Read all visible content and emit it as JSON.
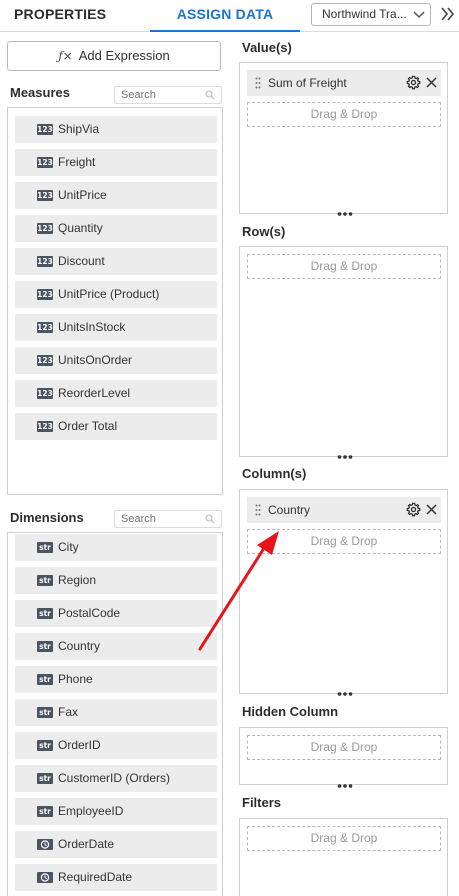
{
  "tabs": {
    "properties": "PROPERTIES",
    "assign_data": "ASSIGN DATA"
  },
  "datasource": {
    "selected": "Northwind Tra..."
  },
  "add_expression": {
    "icon_text": "ƒ×",
    "label": "Add Expression"
  },
  "measures": {
    "title": "Measures",
    "search_placeholder": "Search",
    "items": [
      {
        "type": "123",
        "label": "ShipVia"
      },
      {
        "type": "123",
        "label": "Freight"
      },
      {
        "type": "123",
        "label": "UnitPrice"
      },
      {
        "type": "123",
        "label": "Quantity"
      },
      {
        "type": "123",
        "label": "Discount"
      },
      {
        "type": "123",
        "label": "UnitPrice (Product)"
      },
      {
        "type": "123",
        "label": "UnitsInStock"
      },
      {
        "type": "123",
        "label": "UnitsOnOrder"
      },
      {
        "type": "123",
        "label": "ReorderLevel"
      },
      {
        "type": "123",
        "label": "Order Total"
      }
    ]
  },
  "dimensions": {
    "title": "Dimensions",
    "search_placeholder": "Search",
    "items": [
      {
        "type": "str",
        "label": "City"
      },
      {
        "type": "str",
        "label": "Region"
      },
      {
        "type": "str",
        "label": "PostalCode"
      },
      {
        "type": "str",
        "label": "Country"
      },
      {
        "type": "str",
        "label": "Phone"
      },
      {
        "type": "str",
        "label": "Fax"
      },
      {
        "type": "str",
        "label": "OrderID"
      },
      {
        "type": "str",
        "label": "CustomerID (Orders)"
      },
      {
        "type": "str",
        "label": "EmployeeID"
      },
      {
        "type": "date",
        "label": "OrderDate"
      },
      {
        "type": "date",
        "label": "RequiredDate"
      }
    ]
  },
  "zones": {
    "values": {
      "title": "Value(s)",
      "chip": "Sum of Freight",
      "drop": "Drag & Drop"
    },
    "rows": {
      "title": "Row(s)",
      "drop": "Drag & Drop"
    },
    "columns": {
      "title": "Column(s)",
      "chip": "Country",
      "drop": "Drag & Drop"
    },
    "hidden": {
      "title": "Hidden Column",
      "drop": "Drag & Drop"
    },
    "filters": {
      "title": "Filters",
      "drop": "Drag & Drop"
    }
  },
  "colors": {
    "accent": "#1a73d9",
    "annotation_arrow": "#e8141c",
    "badge": "#4a5462"
  }
}
